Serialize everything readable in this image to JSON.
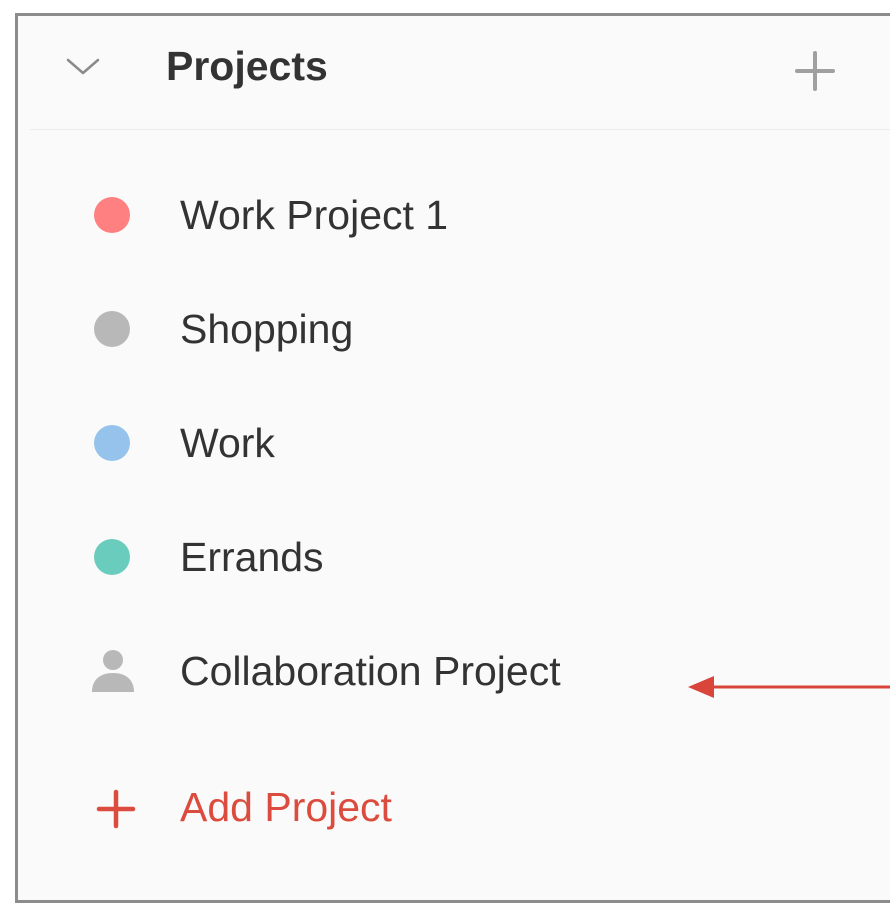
{
  "header": {
    "title": "Projects",
    "collapse_icon": "chevron-down-icon",
    "add_icon": "plus-icon"
  },
  "projects": [
    {
      "label": "Work Project 1",
      "icon": "color-dot",
      "color": "#ff8080"
    },
    {
      "label": "Shopping",
      "icon": "color-dot",
      "color": "#b8b8b8"
    },
    {
      "label": "Work",
      "icon": "color-dot",
      "color": "#96c3eb"
    },
    {
      "label": "Errands",
      "icon": "color-dot",
      "color": "#6accbc"
    },
    {
      "label": "Collaboration Project",
      "icon": "person-icon",
      "color": "#b8b8b8"
    }
  ],
  "add_project": {
    "label": "Add Project",
    "icon": "plus-icon",
    "color": "#db4c3f"
  },
  "annotation": {
    "icon": "arrow-left-icon",
    "color": "#d9453b"
  }
}
